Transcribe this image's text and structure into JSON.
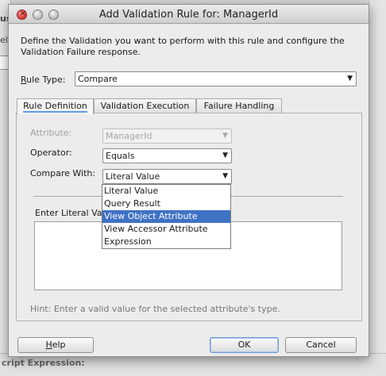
{
  "background": {
    "fragment_top": "us",
    "fragment_second": "ele",
    "fragment_bottom": "cript Expression:"
  },
  "dialog": {
    "title": "Add Validation Rule for: ManagerId",
    "description": "Define the Validation you want to perform with this rule and configure the Validation Failure response.",
    "rule_type": {
      "label": "Rule Type:",
      "value": "Compare"
    },
    "tabs": [
      {
        "label": "Rule Definition",
        "active": true
      },
      {
        "label": "Validation Execution",
        "active": false
      },
      {
        "label": "Failure Handling",
        "active": false
      }
    ],
    "attribute": {
      "label": "Attribute:",
      "value": "ManagerId",
      "disabled": true
    },
    "operator": {
      "label": "Operator:",
      "value": "Equals"
    },
    "compare_with": {
      "label": "Compare With:",
      "value": "Literal Value",
      "options": [
        "Literal Value",
        "Query Result",
        "View Object Attribute",
        "View Accessor Attribute",
        "Expression"
      ],
      "highlighted_index": 2
    },
    "literal_label": "Enter Literal Valu",
    "hint": "Hint: Enter a valid value for the selected attribute's type.",
    "buttons": {
      "help": "Help",
      "ok": "OK",
      "cancel": "Cancel"
    }
  },
  "colors": {
    "selection": "#3f72c5",
    "close_button": "#d4302a",
    "tab_accent": "#5f9de3"
  }
}
